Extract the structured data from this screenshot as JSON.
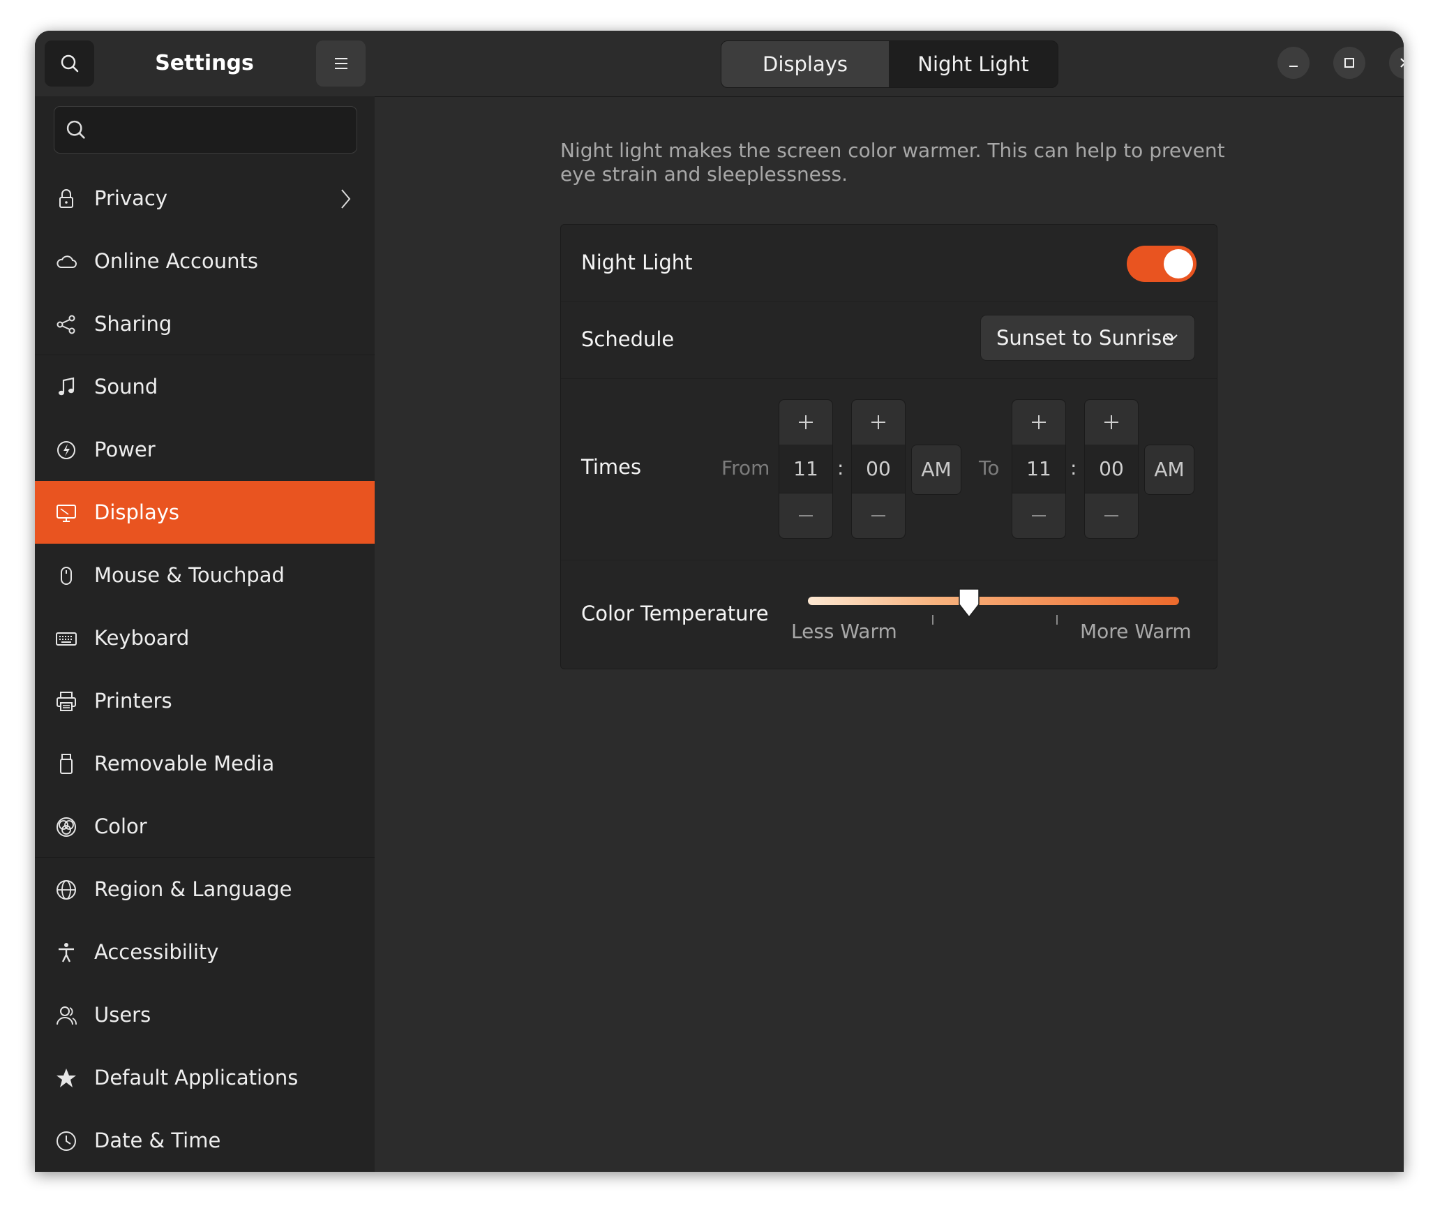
{
  "window": {
    "title": "Settings"
  },
  "sidebar": {
    "search_placeholder": "",
    "items": [
      {
        "label": "Privacy",
        "icon": "lock-icon",
        "has_chevron": true
      },
      {
        "label": "Online Accounts",
        "icon": "cloud-icon"
      },
      {
        "label": "Sharing",
        "icon": "share-icon"
      },
      {
        "label": "Sound",
        "icon": "music-note-icon"
      },
      {
        "label": "Power",
        "icon": "power-icon"
      },
      {
        "label": "Displays",
        "icon": "display-icon",
        "active": true
      },
      {
        "label": "Mouse & Touchpad",
        "icon": "mouse-icon"
      },
      {
        "label": "Keyboard",
        "icon": "keyboard-icon"
      },
      {
        "label": "Printers",
        "icon": "printer-icon"
      },
      {
        "label": "Removable Media",
        "icon": "usb-drive-icon"
      },
      {
        "label": "Color",
        "icon": "color-icon"
      },
      {
        "label": "Region & Language",
        "icon": "globe-icon"
      },
      {
        "label": "Accessibility",
        "icon": "accessibility-icon"
      },
      {
        "label": "Users",
        "icon": "users-icon"
      },
      {
        "label": "Default Applications",
        "icon": "star-icon"
      },
      {
        "label": "Date & Time",
        "icon": "clock-icon"
      }
    ]
  },
  "header": {
    "tabs": [
      {
        "label": "Displays",
        "selected": false
      },
      {
        "label": "Night Light",
        "selected": true
      }
    ]
  },
  "night_light": {
    "description": "Night light makes the screen color warmer. This can help to prevent eye strain and sleeplessness.",
    "toggle_label": "Night Light",
    "toggle_on": true,
    "schedule_label": "Schedule",
    "schedule_value": "Sunset to Sunrise",
    "times_label": "Times",
    "from_label": "From",
    "to_label": "To",
    "from": {
      "hours": "11",
      "minutes": "00",
      "period": "AM"
    },
    "to": {
      "hours": "11",
      "minutes": "00",
      "period": "AM"
    },
    "separator": ":",
    "color_temp_label": "Color Temperature",
    "less_warm": "Less Warm",
    "more_warm": "More Warm",
    "slider_value": 0.34
  },
  "colors": {
    "accent": "#e95420",
    "bg": "#2c2c2c",
    "sidebar": "#232323"
  }
}
